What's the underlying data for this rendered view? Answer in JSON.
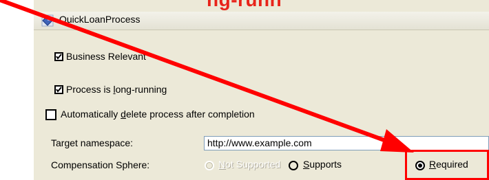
{
  "annotation": {
    "banner_text": "ng-runn",
    "color": "#ff0000"
  },
  "window": {
    "title": "QuickLoanProcess",
    "icon": "process-diamond-icon"
  },
  "options": {
    "business_relevant": {
      "label": "Business Relevant",
      "checked": true
    },
    "long_running": {
      "label_pre": "Process is ",
      "label_u": "l",
      "label_post": "ong-running",
      "checked": true
    },
    "auto_delete": {
      "label_pre": "Automatically ",
      "label_u": "d",
      "label_post": "elete process after completion",
      "checked": false
    }
  },
  "target_namespace": {
    "label": "Target namespace:",
    "value": "http://www.example.com"
  },
  "compensation": {
    "label": "Compensation Sphere:",
    "options": [
      {
        "u": "N",
        "rest": "ot Supported",
        "checked": false,
        "disabled": true
      },
      {
        "u": "S",
        "rest": "upports",
        "checked": false,
        "disabled": false
      },
      {
        "u": "R",
        "rest": "equired",
        "checked": true,
        "disabled": false
      }
    ]
  }
}
